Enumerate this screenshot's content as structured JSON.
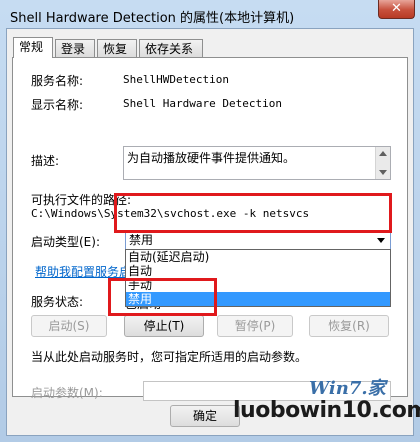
{
  "window": {
    "title": "Shell Hardware Detection 的属性(本地计算机)",
    "close": "✕"
  },
  "tabs": [
    "常规",
    "登录",
    "恢复",
    "依存关系"
  ],
  "general": {
    "service_name_label": "服务名称:",
    "service_name": "ShellHWDetection",
    "display_name_label": "显示名称:",
    "display_name": "Shell Hardware Detection",
    "description_label": "描述:",
    "description": "为自动播放硬件事件提供通知。",
    "path_label": "可执行文件的路径:",
    "path": "C:\\Windows\\System32\\svchost.exe -k netsvcs",
    "startup_type_label": "启动类型(E):",
    "startup_type_selected": "禁用",
    "startup_options": [
      "自动(延迟启动)",
      "自动",
      "手动",
      "禁用"
    ],
    "startup_selected_index": 3,
    "help_link": "帮助我配置服务启动",
    "status_label": "服务状态:",
    "status_value": "已启动",
    "buttons": {
      "start": "启动(S)",
      "stop": "停止(T)",
      "pause": "暂停(P)",
      "resume": "恢复(R)"
    },
    "hint": "当从此处启动服务时，您可指定所适用的启动参数。",
    "params_label": "启动参数(M):",
    "params_value": ""
  },
  "footer": {
    "ok": "确定"
  },
  "watermark": {
    "logo": "Win7.家",
    "site": "luobowin10.com"
  }
}
